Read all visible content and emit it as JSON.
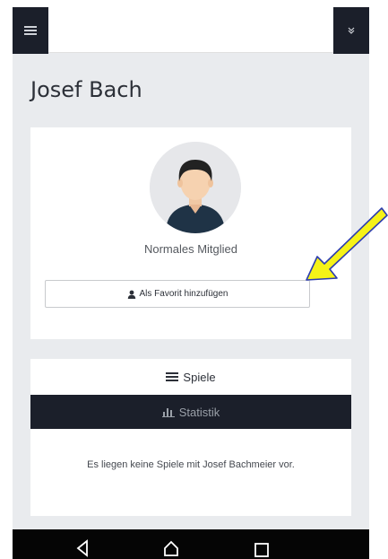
{
  "profile": {
    "name": "Josef Bach",
    "member_type": "Normales Mitglied",
    "favorite_button": "Als Favorit hinzufügen"
  },
  "tabs": [
    {
      "label": "Spiele"
    },
    {
      "label": "Statistik"
    }
  ],
  "empty_message": "Es liegen keine Spiele mit Josef Bachmeier vor.",
  "colors": {
    "dark": "#1b1f2a",
    "background": "#e9ebee",
    "arrow_fill": "#f5f218",
    "arrow_stroke": "#2b3bb0"
  },
  "icons": [
    "menu-icon",
    "chevron-down-icon",
    "user-icon",
    "list-icon",
    "bar-chart-icon",
    "back-icon",
    "home-icon",
    "recent-apps-icon"
  ]
}
